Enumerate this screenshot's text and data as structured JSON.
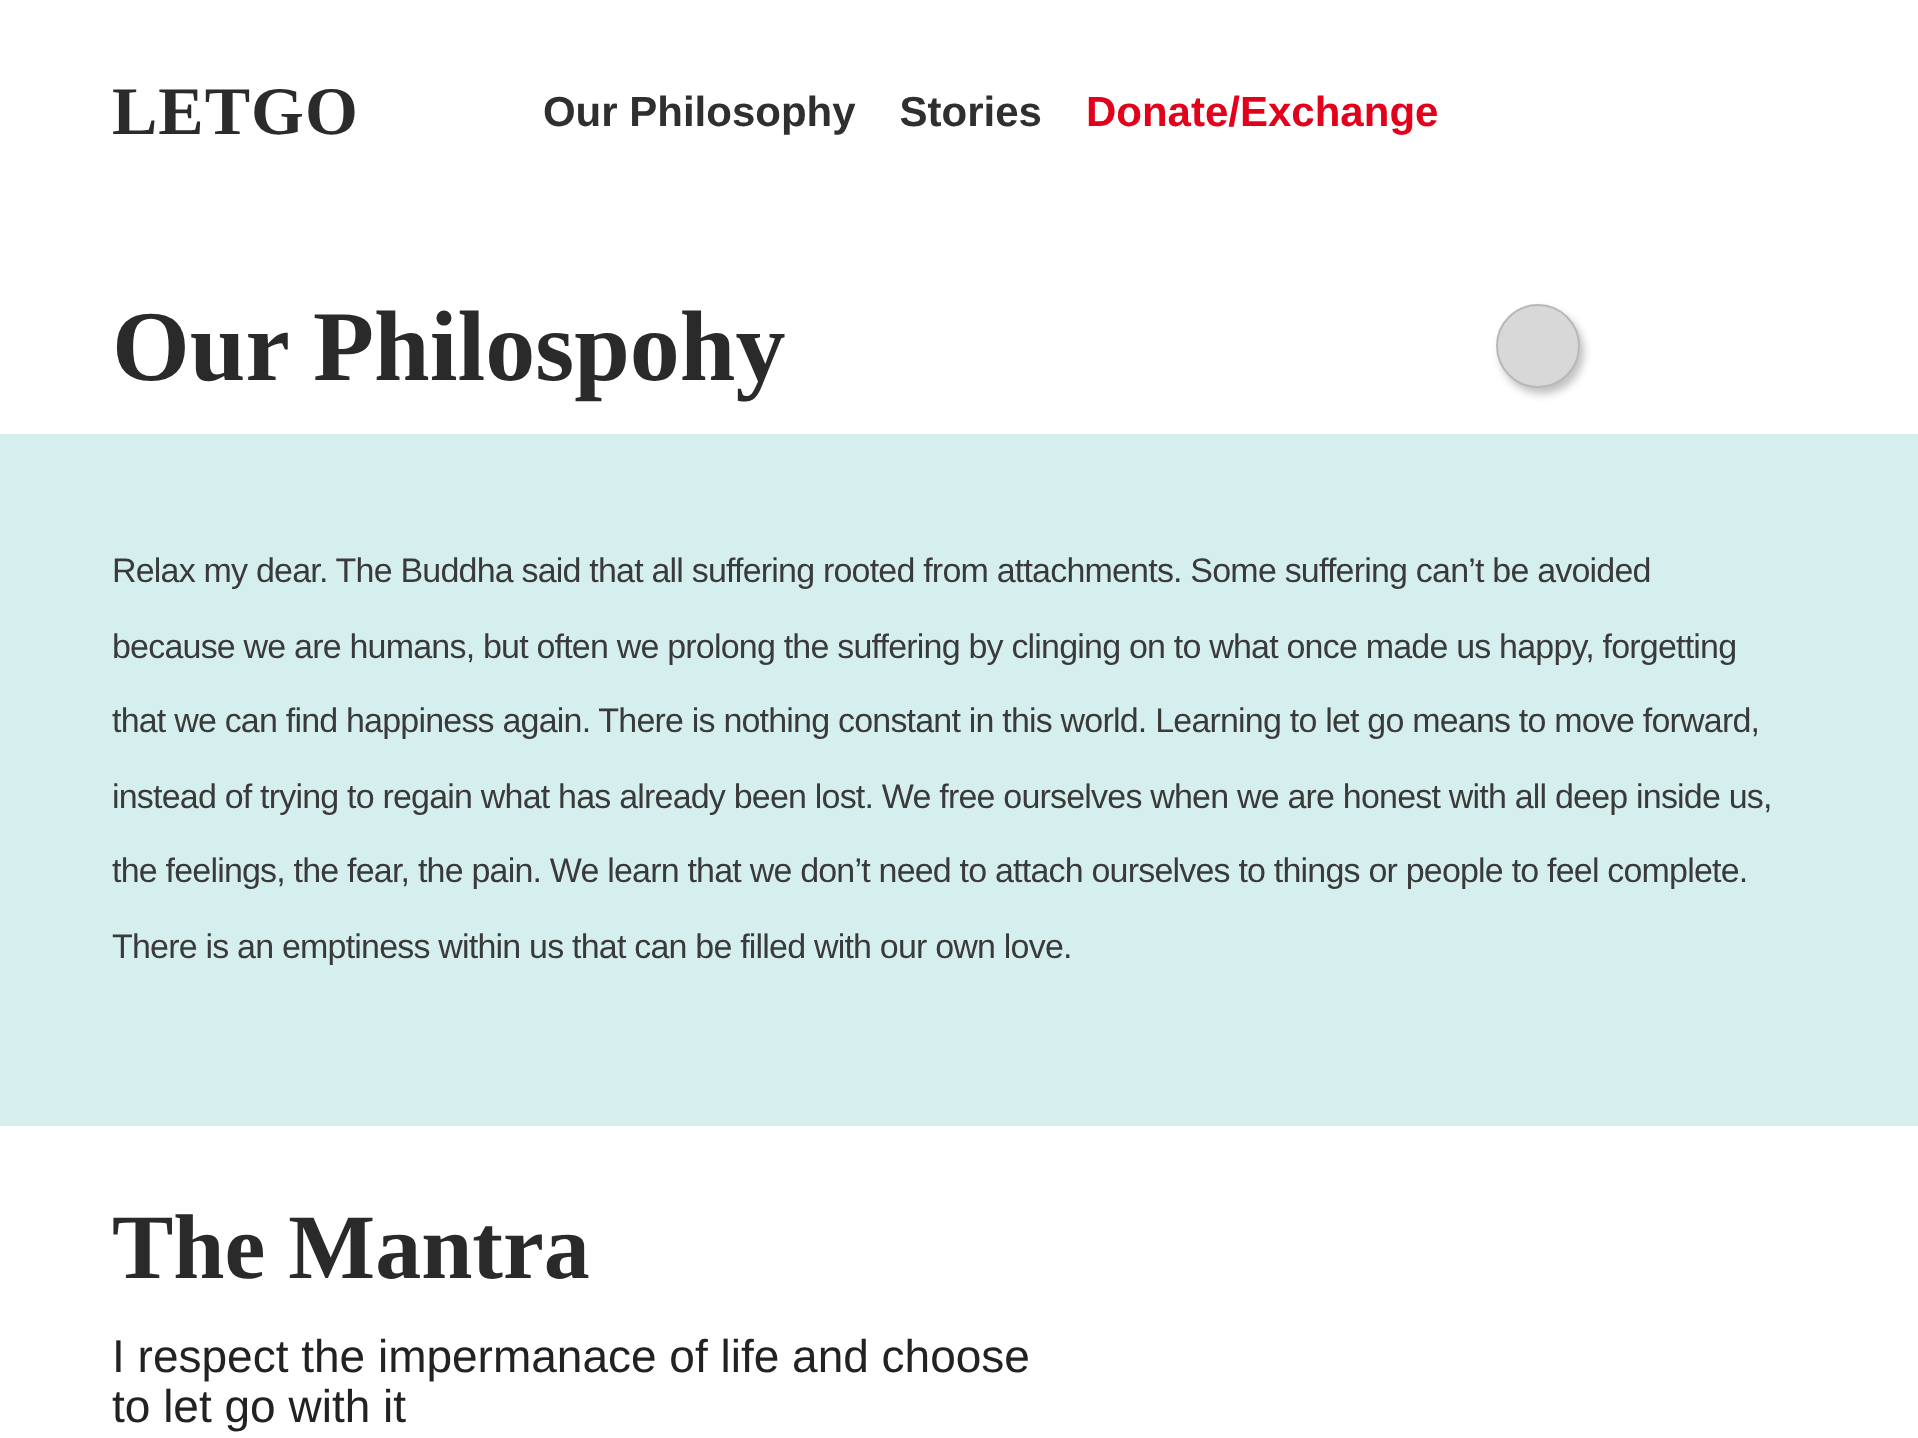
{
  "logo": "LETGO",
  "nav": [
    {
      "label": "Our Philosophy",
      "selected": false
    },
    {
      "label": "Stories",
      "selected": false
    },
    {
      "label": "Donate/Exchange",
      "selected": true
    }
  ],
  "philosophy": {
    "heading": "Our Philospohy",
    "body": "Relax my dear. The Buddha said that all suffering rooted from attachments. Some suffering can’t be avoided because we are humans, but often we prolong the suffering by clinging on to what once made us happy, forgetting that we can find happiness again. There is nothing constant in this world. Learning to let go means to move forward, instead of trying to regain what has already been lost. We free ourselves when we are honest with all deep inside us, the feelings, the fear, the pain. We learn that we don’t need to attach ourselves to things or people to feel complete. There is an emptiness within us that can be filled with our own love."
  },
  "mantra": {
    "heading": "The Mantra",
    "text": "I respect the impermanace of life and choose to let go with it"
  }
}
